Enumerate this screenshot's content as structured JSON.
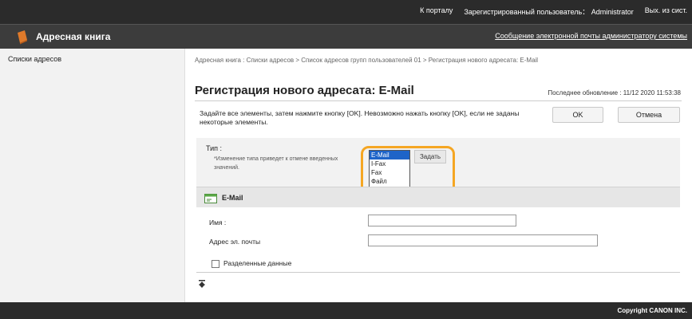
{
  "topbar": {
    "portal_link": "К порталу",
    "registered_user": "Зарегистрированный пользователь： Administrator",
    "logout_link": "Вых. из сист."
  },
  "app": {
    "title": "Адресная книга",
    "admin_mail_link": "Сообщение электронной почты администратору системы"
  },
  "sidebar": {
    "items": [
      {
        "label": "Списки адресов"
      }
    ]
  },
  "main": {
    "breadcrumb": "Адресная книга : Списки адресов > Список адресов групп пользователей 01 > Регистрация нового адресата: E-Mail",
    "page_title": "Регистрация нового адресата: E-Mail",
    "last_update": "Последнее обновление : 11/12 2020 11:53:38",
    "instruction": "Задайте все элементы, затем нажмите кнопку [OK]. Невозможно нажать кнопку [OK], если не заданы некоторые элементы.",
    "ok_label": "OK",
    "cancel_label": "Отмена"
  },
  "type_section": {
    "label": "Тип :",
    "note": "*Изменение типа приведет к отмене введенных значений.",
    "options": [
      "E-Mail",
      "I-Fax",
      "Fax",
      "Файл"
    ],
    "selected": "E-Mail",
    "set_button_label": "Задать"
  },
  "email_section": {
    "title": "E-Mail",
    "name_label": "Имя :",
    "name_value": "",
    "email_label": "Адрес эл. почты",
    "email_value": "",
    "divided_data_label": "Разделенные данные"
  },
  "footer": {
    "copyright": "Copyright CANON INC."
  },
  "colors": {
    "highlight": "#f5a623",
    "selected_option": "#1e64c8"
  }
}
